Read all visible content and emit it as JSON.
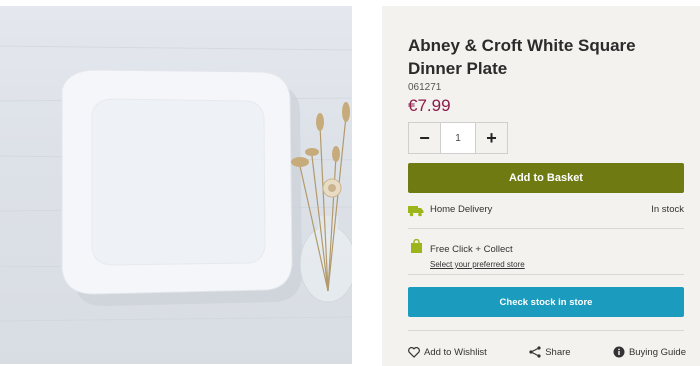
{
  "product": {
    "title": "Abney & Croft White Square Dinner Plate",
    "sku": "061271",
    "price": "€7.99",
    "image_alt": "White square dinner plate beside a glass vase of dried flowers"
  },
  "quantity": {
    "decrement_label": "−",
    "increment_label": "+",
    "value": "1"
  },
  "buttons": {
    "add_to_basket": "Add to Basket",
    "check_stock": "Check stock in store"
  },
  "delivery": {
    "home_label": "Home Delivery",
    "home_status": "In stock",
    "click_label": "Free Click + Collect",
    "click_link": "Select your preferred store"
  },
  "actions": {
    "wishlist": "Add to Wishlist",
    "share": "Share",
    "guide": "Buying Guide"
  },
  "colors": {
    "basket_button": "#6f7a12",
    "stock_button": "#1b9bbd",
    "price": "#8a1d4b",
    "delivery_icon": "#9bb51a"
  },
  "icons": {
    "delivery": "truck-icon",
    "collect": "shopping-bag-icon",
    "wishlist": "heart-icon",
    "share": "share-icon",
    "guide": "info-icon"
  }
}
